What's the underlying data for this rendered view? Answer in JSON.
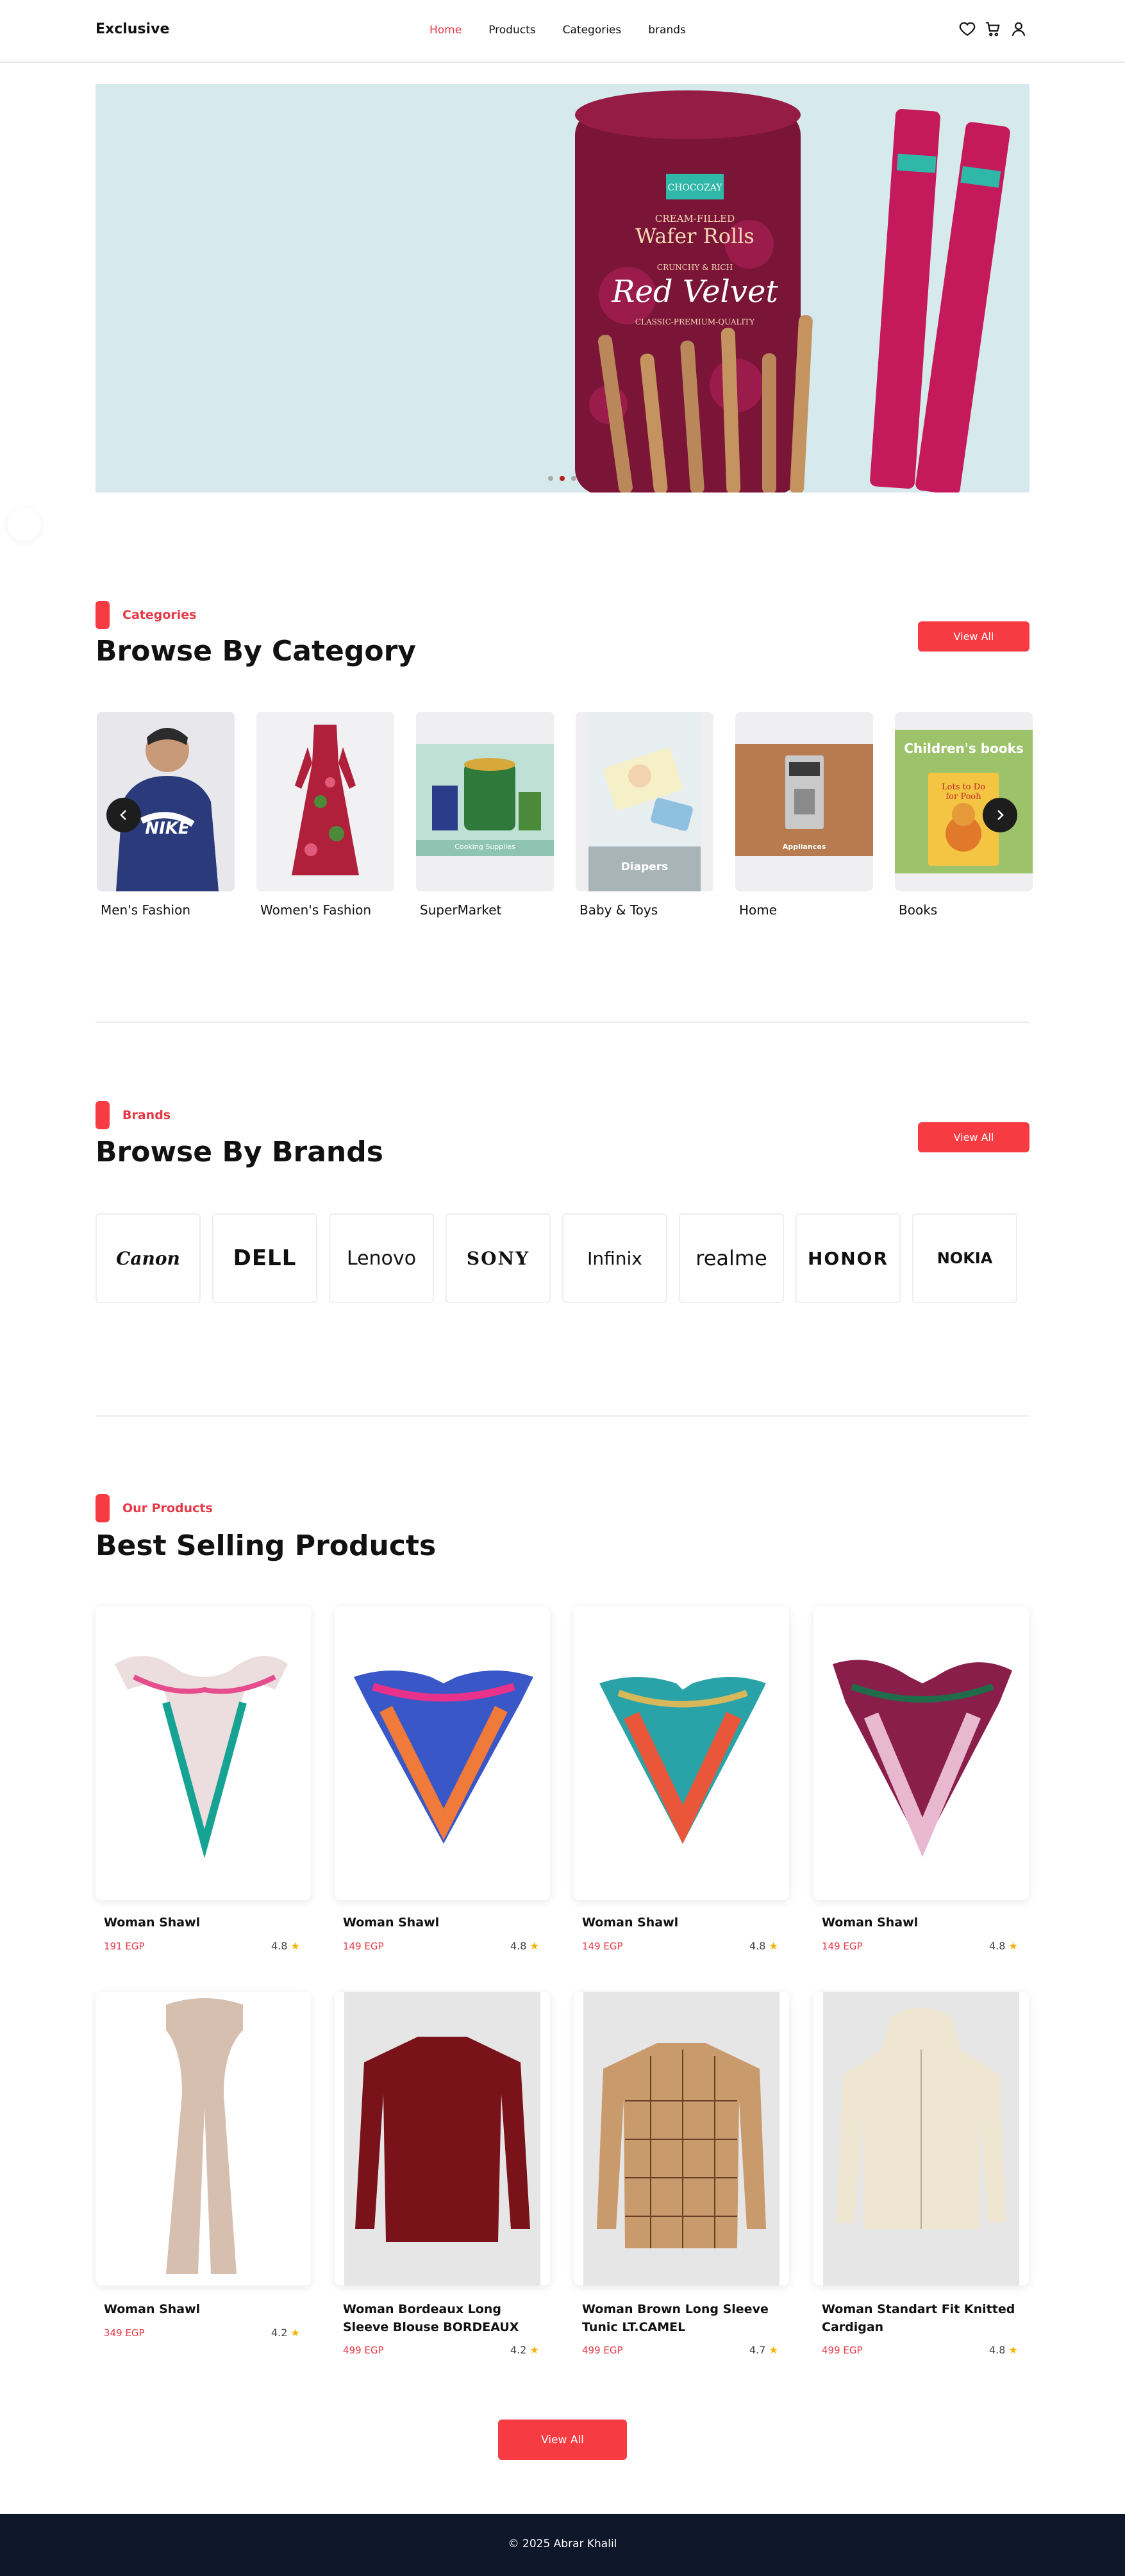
{
  "header": {
    "logo": "Exclusive",
    "nav": [
      {
        "label": "Home",
        "active": true
      },
      {
        "label": "Products",
        "active": false
      },
      {
        "label": "Categories",
        "active": false
      },
      {
        "label": "brands",
        "active": false
      }
    ],
    "icons": [
      "heart-icon",
      "cart-icon",
      "user-icon"
    ]
  },
  "hero": {
    "slides": 3,
    "active_slide": 2,
    "product_text": {
      "brand": "CHOCOZAY",
      "line1": "CREAM-FILLED",
      "line2": "Wafer Rolls",
      "line3": "CRUNCHY & RICH",
      "line4": "Red Velvet",
      "line5": "CLASSIC-PREMIUM-QUALITY"
    }
  },
  "categories": {
    "tag": "Categories",
    "title": "Browse By Category",
    "view_all": "View All",
    "items": [
      {
        "name": "Men's Fashion"
      },
      {
        "name": "Women's Fashion"
      },
      {
        "name": "SuperMarket",
        "image_caption": "Cooking Supplies"
      },
      {
        "name": "Baby & Toys",
        "image_caption": "Diapers"
      },
      {
        "name": "Home",
        "image_caption": "Appliances"
      },
      {
        "name": "Books",
        "image_caption": "Children's books",
        "book_title": "Lots to Do for Pooh"
      }
    ]
  },
  "brands": {
    "tag": "Brands",
    "title": "Browse By Brands",
    "view_all": "View All",
    "items": [
      "Canon",
      "DELL",
      "Lenovo",
      "SONY",
      "Infinix",
      "realme",
      "HONOR",
      "NOKIA"
    ]
  },
  "products": {
    "tag": "Our Products",
    "title": "Best Selling Products",
    "view_all": "View All",
    "items": [
      {
        "name": "Woman Shawl",
        "price": "191 EGP",
        "rating": "4.8"
      },
      {
        "name": "Woman Shawl",
        "price": "149 EGP",
        "rating": "4.8"
      },
      {
        "name": "Woman Shawl",
        "price": "149 EGP",
        "rating": "4.8"
      },
      {
        "name": "Woman Shawl",
        "price": "149 EGP",
        "rating": "4.8"
      },
      {
        "name": "Woman Shawl",
        "price": "349 EGP",
        "rating": "4.2"
      },
      {
        "name": "Woman Bordeaux Long Sleeve Blouse BORDEAUX",
        "price": "499 EGP",
        "rating": "4.2"
      },
      {
        "name": "Woman Brown Long Sleeve Tunic LT.CAMEL",
        "price": "499 EGP",
        "rating": "4.7"
      },
      {
        "name": "Woman Standart Fit Knitted Cardigan",
        "price": "499 EGP",
        "rating": "4.8"
      }
    ]
  },
  "footer": {
    "text": "©  2025 Abrar Khalil"
  },
  "colors": {
    "accent": "#f63b43",
    "footer_bg": "#0f172a",
    "hero_bg": "#d6e9ec",
    "star": "#f5b301"
  }
}
